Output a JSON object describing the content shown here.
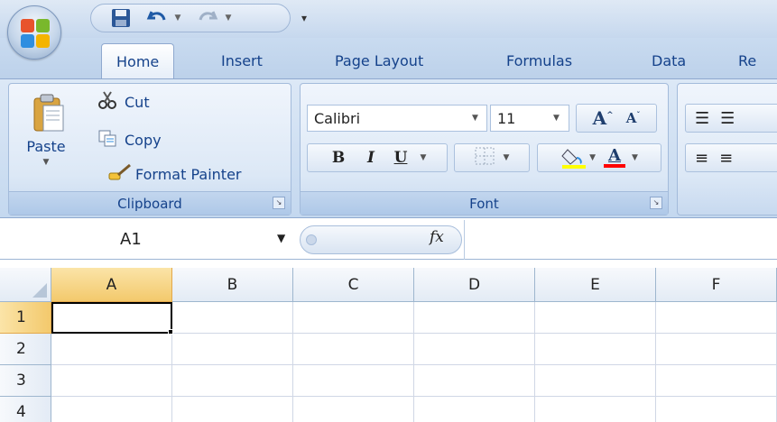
{
  "quick_access": {
    "save_icon": "save-icon",
    "undo_icon": "undo-icon",
    "redo_icon": "redo-icon",
    "customize_icon": "customize-qat-icon"
  },
  "tabs": [
    {
      "label": "Home",
      "active": true
    },
    {
      "label": "Insert",
      "active": false
    },
    {
      "label": "Page Layout",
      "active": false
    },
    {
      "label": "Formulas",
      "active": false
    },
    {
      "label": "Data",
      "active": false
    },
    {
      "label": "Re",
      "active": false
    }
  ],
  "clipboard": {
    "group_label": "Clipboard",
    "paste_label": "Paste",
    "cut_label": "Cut",
    "copy_label": "Copy",
    "format_painter_label": "Format Painter"
  },
  "font": {
    "group_label": "Font",
    "font_name": "Calibri",
    "font_size": "11",
    "grow_label": "A",
    "shrink_label": "A",
    "bold_label": "B",
    "italic_label": "I",
    "underline_label": "U",
    "font_color_label": "A",
    "highlight_color": "#ffff00",
    "font_color": "#ff0000"
  },
  "formula_bar": {
    "name_box": "A1",
    "fx_label": "fx",
    "formula_value": ""
  },
  "grid": {
    "columns": [
      "A",
      "B",
      "C",
      "D",
      "E",
      "F"
    ],
    "rows": [
      "1",
      "2",
      "3",
      "4"
    ],
    "selected_cell": "A1"
  },
  "colors": {
    "ribbon_text": "#15428b",
    "selection_header": "#f3c96c"
  }
}
